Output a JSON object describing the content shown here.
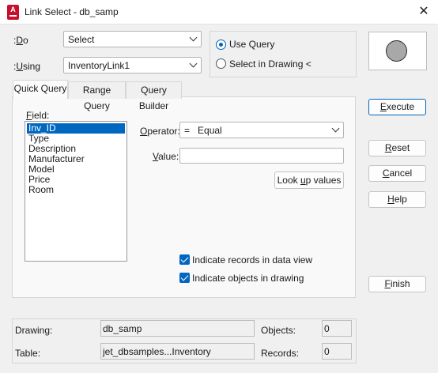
{
  "window": {
    "title": "Link Select - db_samp",
    "app_icon": "autocad-icon",
    "close_glyph": "✕"
  },
  "do": {
    "label": ":Do",
    "value": "Select"
  },
  "using": {
    "label": ":Using",
    "value": "InventoryLink1"
  },
  "mode": {
    "use_query": "Use Query",
    "select_in_drawing": "Select in Drawing <",
    "selected": "use_query"
  },
  "tabs": [
    {
      "label": "Quick Query",
      "active": true
    },
    {
      "label": "Range Query",
      "active": false
    },
    {
      "label": "Query Builder",
      "active": false
    }
  ],
  "quick_query": {
    "field_label": "Field:",
    "fields": [
      "Inv_ID",
      "Type",
      "Description",
      "Manufacturer",
      "Model",
      "Price",
      "Room"
    ],
    "selected_field": "Inv_ID",
    "operator_label": "Operator:",
    "operator_value": "=   Equal",
    "value_label": "Value:",
    "value": "",
    "lookup_label": "Look up values",
    "indicate_records": "Indicate records in data view",
    "indicate_objects": "Indicate objects in drawing",
    "indicate_records_checked": true,
    "indicate_objects_checked": true
  },
  "buttons": {
    "execute": "Execute",
    "reset": "Reset",
    "cancel": "Cancel",
    "help": "Help",
    "finish": "Finish"
  },
  "info": {
    "drawing_label": "Drawing:",
    "drawing_value": "db_samp",
    "table_label": "Table:",
    "table_value": "jet_dbsamples...Inventory",
    "objects_label": "Objects:",
    "objects_value": "0",
    "records_label": "Records:",
    "records_value": "0"
  },
  "colors": {
    "accent": "#0067c0",
    "app_icon": "#c8102e"
  }
}
